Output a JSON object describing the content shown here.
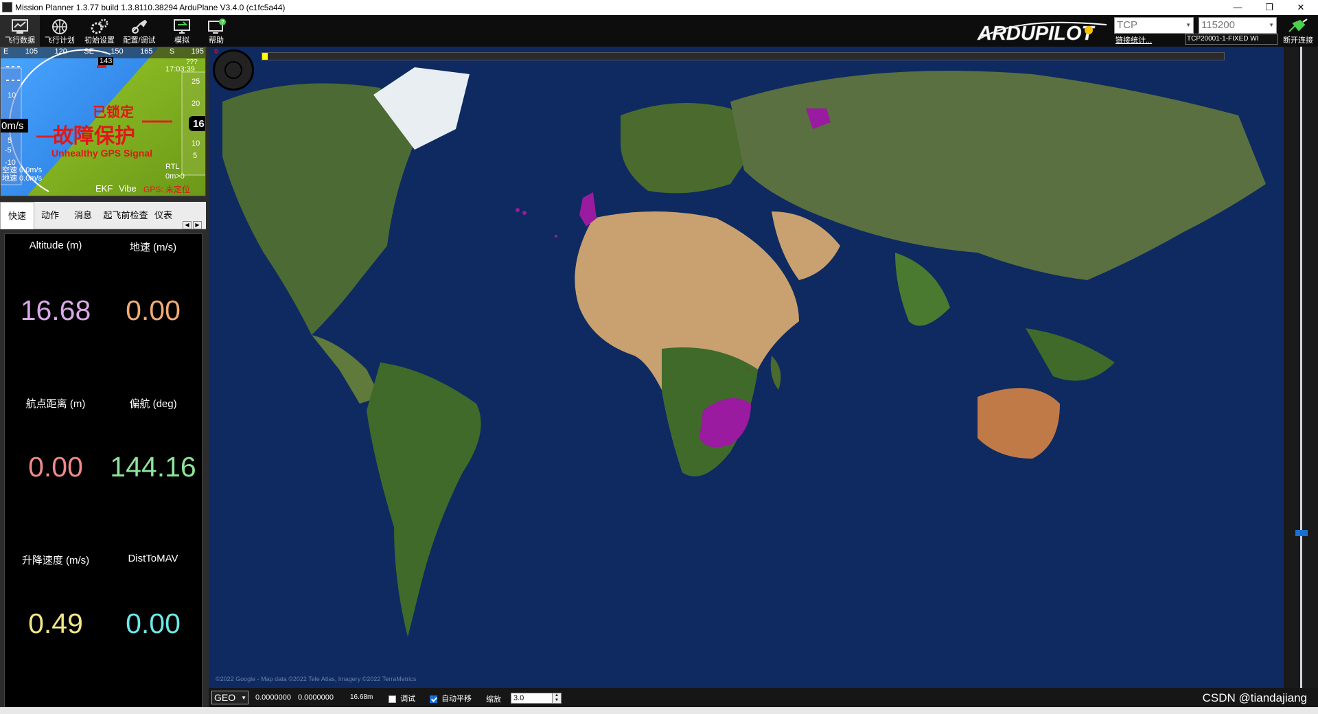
{
  "window": {
    "title": "Mission Planner 1.3.77 build 1.3.8110.38294 ArduPlane V3.4.0 (c1fc5a44)",
    "minimize": "—",
    "restore": "❐",
    "close": "✕"
  },
  "toolbar": {
    "buttons": [
      {
        "label": "飞行数据",
        "icon": "flight-data-icon"
      },
      {
        "label": "飞行计划",
        "icon": "flight-plan-icon"
      },
      {
        "label": "初始设置",
        "icon": "initial-setup-icon"
      },
      {
        "label": "配置/调试",
        "icon": "config-tuning-icon"
      },
      {
        "label": "模拟",
        "icon": "simulation-icon"
      },
      {
        "label": "帮助",
        "icon": "help-icon"
      }
    ],
    "logo_text": "ARDUPILOT",
    "connection_type": "TCP",
    "baud_rate": "115200",
    "link_stats": "链接统计...",
    "connection_id": "TCP20001-1-FIXED WI",
    "disconnect_label": "断开连接"
  },
  "hud": {
    "heading_ticks": [
      "E",
      "105",
      "120",
      "SE",
      "150",
      "165",
      "S",
      "195"
    ],
    "heading_value": "143",
    "clock": "17:03:39",
    "clock_prefix": "???",
    "airspeed": "0m/s",
    "altitude": "16",
    "speed_scale": [
      "10",
      "5",
      "-5",
      "-10"
    ],
    "alt_scale": [
      "25",
      "20",
      "10",
      "5"
    ],
    "status_disarmed": "已锁定",
    "status_failsafe": "故障保护",
    "status_gps": "Unhealthy GPS Signal",
    "airspeed_text": "空速 0.0m/s",
    "groundspeed_text": "地速 0.0m/s",
    "mode": "RTL",
    "wp_info": "0m>0",
    "ekf": "EKF",
    "vibe": "Vibe",
    "gps_state": "GPS: 未定位",
    "colors": {
      "sky": "#2f8df0",
      "ground": "#7fb51a"
    }
  },
  "tabs": [
    {
      "label": "快速",
      "active": true
    },
    {
      "label": "动作",
      "active": false
    },
    {
      "label": "消息",
      "active": false
    },
    {
      "label": "起飞前检查",
      "active": false
    },
    {
      "label": "仪表",
      "active": false
    }
  ],
  "quick": [
    {
      "label": "Altitude (m)",
      "value": "16.68",
      "color": "#d8a8e8"
    },
    {
      "label": "地速 (m/s)",
      "value": "0.00",
      "color": "#f2ab76"
    },
    {
      "label": "航点距离 (m)",
      "value": "0.00",
      "color": "#f08a8a"
    },
    {
      "label": "偏航 (deg)",
      "value": "144.16",
      "color": "#8ee39b"
    },
    {
      "label": "升降速度 (m/s)",
      "value": "0.49",
      "color": "#f0e68a"
    },
    {
      "label": "DistToMAV",
      "value": "0.00",
      "color": "#6ee8e8"
    }
  ],
  "map": {
    "timeline_start": "0",
    "attribution": "©2022 Google - Map data ©2022 Tele Atlas, Imagery ©2022 TerraMetrics",
    "ocean_color": "#0e2a5c",
    "land_color": "#3f5e2a",
    "desert_color": "#c9a170",
    "track_color": "#9a1aa0"
  },
  "statusbar": {
    "coord_system": "GEO",
    "lat": "0.0000000",
    "lng": "0.0000000",
    "alt": "16.68m",
    "debug_label": "调试",
    "autopan_label": "自动平移",
    "zoom_label": "缩放",
    "zoom_value": "3.0",
    "watermark": "CSDN @tiandajiang"
  }
}
